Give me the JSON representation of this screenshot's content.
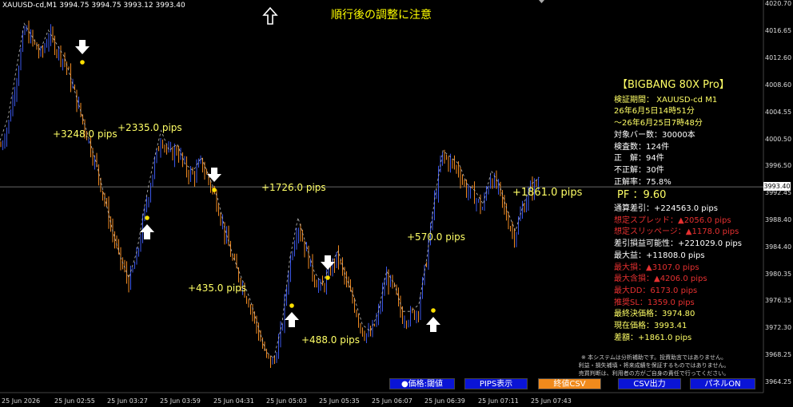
{
  "header": {
    "symbol_info": "XAUUSD-cd,M1  3994.75 3994.75 3993.12 3993.40"
  },
  "warning": "順行後の調整に注意",
  "panel": {
    "title": "【BIGBANG 80X Pro】",
    "lines": [
      {
        "text": "検証期間：  XAUUSD-cd M1",
        "color": "y"
      },
      {
        "text": "26年6月5日14時51分",
        "color": "y"
      },
      {
        "text": "～26年6月25日7時48分",
        "color": "y"
      },
      {
        "text": "対象バー数：30000本",
        "color": "w"
      },
      {
        "text": "検査数：124件",
        "color": "w"
      },
      {
        "text": "正　解：94件",
        "color": "w"
      },
      {
        "text": "不正解：30件",
        "color": "w"
      },
      {
        "text": "正解率：75.8%",
        "color": "w"
      }
    ],
    "pf": "PF  ：9.60",
    "stats": [
      {
        "text": "通算差引：+224563.0 pips",
        "color": "w"
      },
      {
        "text": "想定スプレッド：▲2056.0 pips",
        "color": "r"
      },
      {
        "text": "想定スリッページ：▲1178.0 pips",
        "color": "r"
      },
      {
        "text": "差引損益可能性：+221029.0 pips",
        "color": "w"
      },
      {
        "text": "最大益：+11808.0 pips",
        "color": "w"
      },
      {
        "text": "最大損：▲3107.0 pips",
        "color": "r"
      },
      {
        "text": "最大含損：▲4206.0 pips",
        "color": "r"
      },
      {
        "text": "最大DD：6173.0 pips",
        "color": "r"
      },
      {
        "text": "推奨SL：1359.0 pips",
        "color": "r"
      },
      {
        "text": "最終決価格：3974.80",
        "color": "y"
      },
      {
        "text": "現在価格：3993.41",
        "color": "y"
      },
      {
        "text": "差額：+1861.0 pips",
        "color": "y"
      }
    ]
  },
  "disclaimer": [
    "※ 本システムは分析補助です。投資助言ではありません。",
    "利益・損失補填・将来成績を保証するものではありません。",
    "売買判断は、利用者の方がご自身の責任で行ってください。"
  ],
  "buttons": [
    {
      "label": "●価格:閾値",
      "color": "#0a14d6"
    },
    {
      "label": "PIPS表示",
      "color": "#0a14d6"
    },
    {
      "label": "終値CSV",
      "color": "#f08a1c"
    },
    {
      "label": "CSV出力",
      "color": "#0a14d6"
    },
    {
      "label": "パネルON",
      "color": "#0a14d6"
    }
  ],
  "pips_labels": [
    "+3248.0 pips",
    "+2335.0 pips",
    "+1726.0 pips",
    "+435.0 pips",
    "+488.0 pips",
    "+570.0 pips",
    "+1861.0 pips"
  ],
  "current_price": "3993.40",
  "chart_data": {
    "type": "candlestick",
    "xlabels": [
      "25 Jun 2026",
      "25 Jun 02:55",
      "25 Jun 03:27",
      "25 Jun 03:59",
      "25 Jun 04:31",
      "25 Jun 05:03",
      "25 Jun 05:35",
      "25 Jun 06:07",
      "25 Jun 06:39",
      "25 Jun 07:11",
      "25 Jun 07:43"
    ],
    "yticks": [
      "4020.70",
      "4016.65",
      "4012.60",
      "4008.60",
      "4004.55",
      "4000.50",
      "3996.50",
      "3992.45",
      "3988.40",
      "3984.40",
      "3980.35",
      "3976.35",
      "3972.30",
      "3968.25",
      "3964.25"
    ],
    "ylim": [
      3962.9,
      4021.3
    ],
    "close_path": [
      3999.5,
      4003,
      4010,
      4017,
      4015,
      4013,
      4016,
      4014,
      4012,
      4008,
      4004,
      4000,
      3996,
      3991,
      3986,
      3982,
      3979,
      3983,
      3990,
      3996,
      4001,
      3998,
      3999,
      3996,
      3995,
      3997,
      3994,
      3991,
      3986,
      3982,
      3979,
      3976,
      3972,
      3968,
      3967,
      3972,
      3982,
      3988,
      3984,
      3980,
      3978,
      3981,
      3983,
      3979,
      3976,
      3972,
      3971,
      3974,
      3980,
      3978,
      3974,
      3974,
      3975,
      3982,
      3991,
      3998,
      3997,
      3996,
      3993,
      3992,
      3990,
      3995,
      3993,
      3989,
      3986,
      3990,
      3993,
      3994
    ],
    "signals": [
      {
        "dir": "down",
        "label": "+3248.0 pips"
      },
      {
        "dir": "up",
        "label": "+2335.0 pips"
      },
      {
        "dir": "down",
        "label": "+1726.0 pips"
      },
      {
        "dir": "up",
        "label": "+435.0 pips"
      },
      {
        "dir": "down",
        "label": "+488.0 pips"
      },
      {
        "dir": "up",
        "label": "+570.0 pips"
      }
    ]
  }
}
